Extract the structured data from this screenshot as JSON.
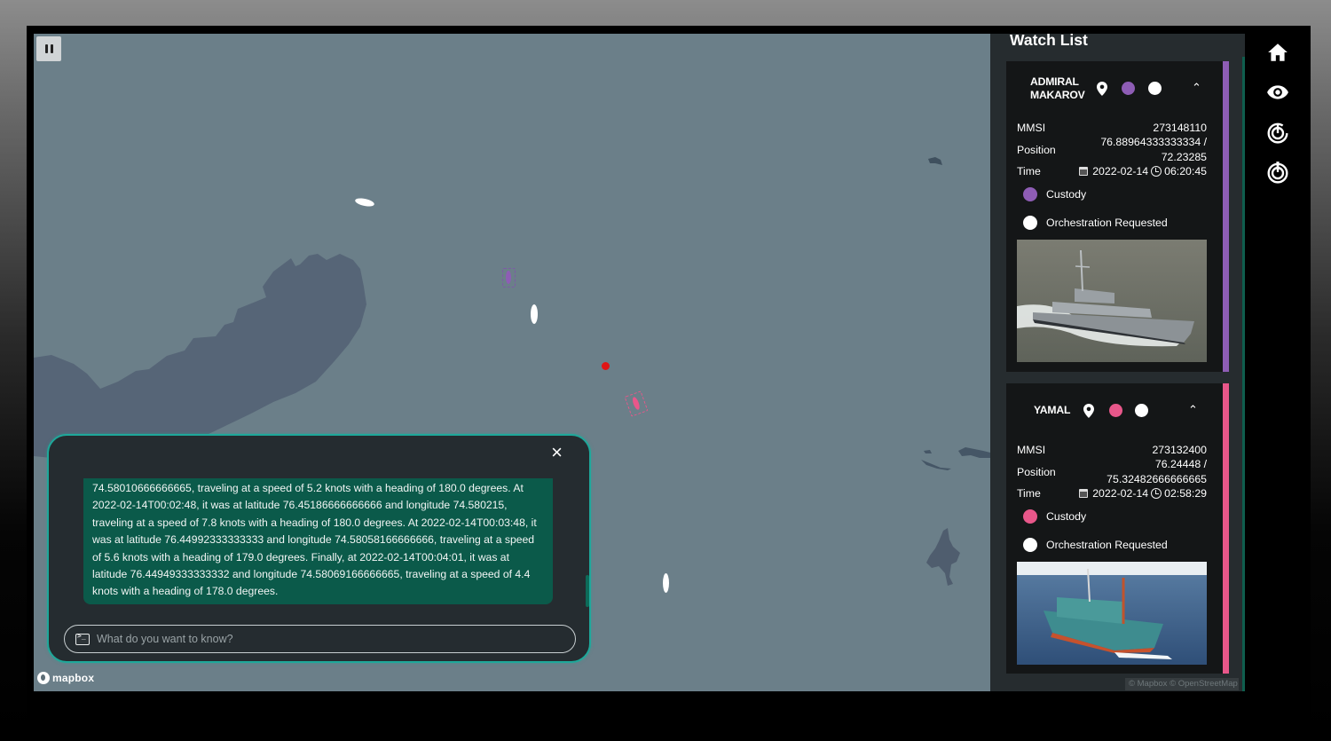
{
  "map": {
    "pause_label": "Pause",
    "attribution": "© Mapbox © OpenStreetMap I",
    "logo_text": "mapbox",
    "colors": {
      "water": "#6b7f89",
      "land": "#566577",
      "selected_purple": "#7d5aa6",
      "selected_pink": "#e8578a",
      "alert": "#e01515"
    }
  },
  "chat": {
    "message": "74.58010666666665, traveling at a speed of 5.2 knots with a heading of 180.0 degrees. At 2022-02-14T00:02:48, it was at latitude 76.45186666666666 and longitude 74.580215, traveling at a speed of 7.8 knots with a heading of 180.0 degrees. At 2022-02-14T00:03:48, it was at latitude 76.44992333333333 and longitude 74.58058166666666, traveling at a speed of 5.6 knots with a heading of 179.0 degrees. Finally, at 2022-02-14T00:04:01, it was at latitude 76.44949333333332 and longitude 74.58069166666665, traveling at a speed of 4.4 knots with a heading of 178.0 degrees.",
    "input_placeholder": "What do you want to know?",
    "input_value": "",
    "close_label": "×",
    "border_color": "#1ea89a",
    "message_bg": "#0b5a4a"
  },
  "watchlist": {
    "title": "Watch List",
    "vessels": [
      {
        "name_line1": "ADMIRAL",
        "name_line2": "MAKAROV",
        "color": "#8e5db5",
        "mmsi_label": "MMSI",
        "mmsi": "273148110",
        "position_label": "Position",
        "position_line1": "76.88964333333334 /",
        "position_line2": "72.23285",
        "time_label": "Time",
        "date": "2022-02-14",
        "time": "06:20:45",
        "legend_custody": "Custody",
        "legend_orchestration": "Orchestration Requested",
        "image_alt": "Grey patrol vessel at sea"
      },
      {
        "name_line1": "YAMAL",
        "name_line2": "",
        "color": "#e8578a",
        "mmsi_label": "MMSI",
        "mmsi": "273132400",
        "position_label": "Position",
        "position_line1": "76.24448 /",
        "position_line2": "75.32482666666665",
        "time_label": "Time",
        "date": "2022-02-14",
        "time": "02:58:29",
        "legend_custody": "Custody",
        "legend_orchestration": "Orchestration Requested",
        "image_alt": "Fishing trawler at sea"
      }
    ]
  },
  "nav": {
    "items": [
      {
        "icon": "home-icon",
        "label": "Home"
      },
      {
        "icon": "eye-icon",
        "label": "Watch"
      },
      {
        "icon": "radar-icon",
        "label": "Radar"
      },
      {
        "icon": "radar-alert-icon",
        "label": "Radar Alert"
      }
    ]
  }
}
